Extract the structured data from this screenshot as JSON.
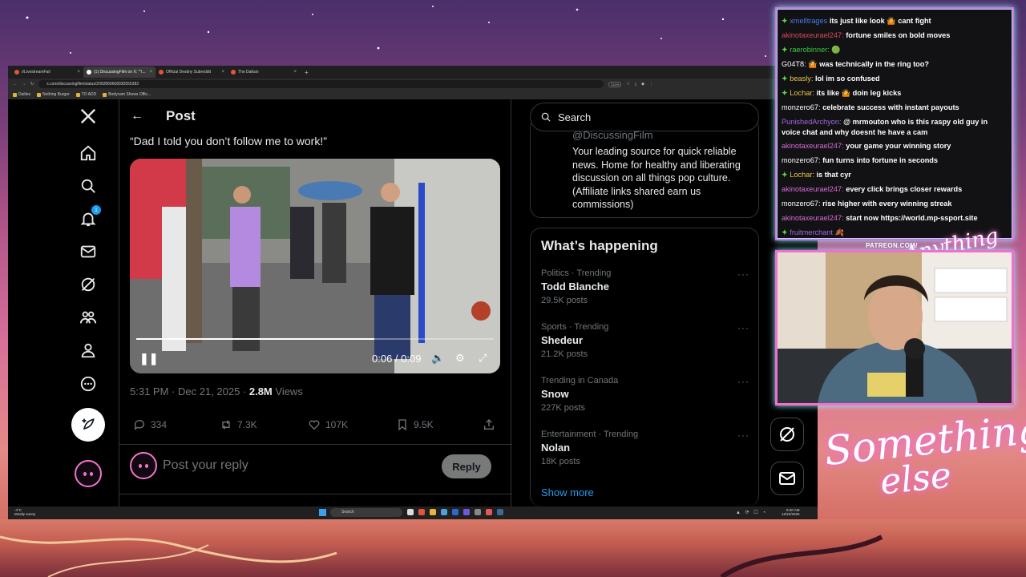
{
  "browser": {
    "tabs": [
      {
        "label": "r/LivestreamFail",
        "active": false
      },
      {
        "label": "(1) DiscussingFilm on X: \"\"I...",
        "active": true
      },
      {
        "label": "Official Destiny Subreddit",
        "active": false
      },
      {
        "label": "The Dalkan",
        "active": false
      }
    ],
    "new_tab": "+",
    "url": "x.com/discussingfilm/status/2002869668930555383",
    "zoom": "210%",
    "bookmarks": [
      "Dailies",
      "Nothing Burger",
      "TO ADD",
      "Bodycam Shows Offic..."
    ]
  },
  "x": {
    "nav_badge": "1",
    "post_header_title": "Post",
    "quote_text": "“Dad I told you don’t follow me to work!”",
    "video": {
      "time": "0:06 / 0:09",
      "progress": 0.667
    },
    "timestamp": "5:31 PM · Dec 21, 2025 · ",
    "views_count": "2.8M",
    "views_label": " Views",
    "actions": {
      "replies": "334",
      "reposts": "7.3K",
      "likes": "107K",
      "bookmarks": "9.5K"
    },
    "reply_placeholder": "Post your reply",
    "reply_button": "Reply",
    "search_placeholder": "Search",
    "profile": {
      "handle": "@DiscussingFilm",
      "bio": "Your leading source for quick reliable news. Home for healthy and liberating discussion on all things pop culture. (Affiliate links shared earn us commissions)"
    },
    "trends_title": "What’s happening",
    "trends": [
      {
        "context": "Politics · Trending",
        "name": "Todd Blanche",
        "count": "29.5K posts"
      },
      {
        "context": "Sports · Trending",
        "name": "Shedeur",
        "count": "21.2K posts"
      },
      {
        "context": "Trending in Canada",
        "name": "Snow",
        "count": "227K posts"
      },
      {
        "context": "Entertainment · Trending",
        "name": "Nolan",
        "count": "18K posts"
      }
    ],
    "show_more": "Show more",
    "more_dots": "···"
  },
  "taskbar": {
    "weather_temp": "-4°C",
    "weather_desc": "Mostly sunny",
    "search": "Search",
    "time": "9:20 AM",
    "date": "12/22/2025"
  },
  "chat": [
    {
      "user": "xmelltrages",
      "color": "blue",
      "star": true,
      "text": "its just like look 🤷 cant fight"
    },
    {
      "user": "akinotaxeurael247:",
      "color": "red",
      "star": false,
      "text": "fortune smiles on bold moves"
    },
    {
      "user": "raerobinner:",
      "color": "green",
      "star": true,
      "text": "🟢"
    },
    {
      "user": "G04T8:",
      "color": "white",
      "star": false,
      "text": "🤷 was technically in the ring too?"
    },
    {
      "user": "beasly:",
      "color": "yellow",
      "star": true,
      "text": "lol im so confused"
    },
    {
      "user": "Lochar:",
      "color": "yellow",
      "star": true,
      "text": "its like 🤷 doin leg kicks"
    },
    {
      "user": "monzero67:",
      "color": "white",
      "star": false,
      "text": "celebrate success with instant payouts"
    },
    {
      "user": "PunishedArchyon:",
      "color": "purple",
      "star": false,
      "text": "@ mrmouton who is this raspy old guy in voice chat and why doesnt he have a cam",
      "wrap": true
    },
    {
      "user": "akinotaxeurael247:",
      "color": "pink",
      "star": false,
      "text": "your game your winning story"
    },
    {
      "user": "monzero67:",
      "color": "white",
      "star": false,
      "text": "fun turns into fortune in seconds"
    },
    {
      "user": "Lochar:",
      "color": "yellow",
      "star": true,
      "text": "is that cyr"
    },
    {
      "user": "akinotaxeurael247:",
      "color": "pink",
      "star": false,
      "text": "every click brings closer rewards"
    },
    {
      "user": "monzero67:",
      "color": "white",
      "star": false,
      "text": "rise higher with every winning streak"
    },
    {
      "user": "akinotaxeurael247:",
      "color": "pink",
      "star": false,
      "text": "start now https://world.mp-ssport.site"
    },
    {
      "user": "fruitmerchant",
      "color": "purple",
      "star": true,
      "text": "🍂"
    }
  ],
  "overlay": {
    "patreon_url": "PATREON.COM/",
    "brand_script_small": "Anything else",
    "brand_line1": "Something",
    "brand_line2": "else"
  }
}
